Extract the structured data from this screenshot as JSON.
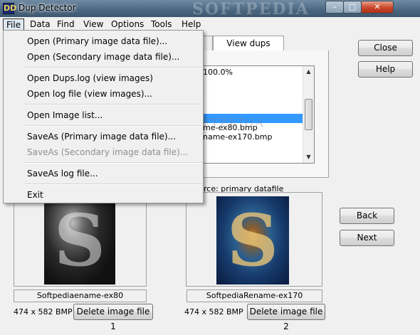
{
  "window": {
    "title": "Dup Detector",
    "watermark": "SOFTPEDIA",
    "app_icon": "DD",
    "minimize_glyph": "–",
    "maximize_glyph": "□",
    "close_glyph": "✕"
  },
  "menubar": {
    "items": [
      "File",
      "Data",
      "Find",
      "View",
      "Options",
      "Tools",
      "Help"
    ],
    "active": "File"
  },
  "file_menu": {
    "groups": [
      [
        {
          "label": "Open (Primary image data file)...",
          "enabled": true
        },
        {
          "label": "Open (Secondary image data file)...",
          "enabled": true
        }
      ],
      [
        {
          "label": "Open Dups.log (view images)",
          "enabled": true
        },
        {
          "label": "Open log file (view images)...",
          "enabled": true
        }
      ],
      [
        {
          "label": "Open Image list...",
          "enabled": true
        }
      ],
      [
        {
          "label": "SaveAs (Primary image data file)...",
          "enabled": true
        },
        {
          "label": "SaveAs (Secondary image data file)...",
          "enabled": false
        }
      ],
      [
        {
          "label": "SaveAs log file...",
          "enabled": true
        }
      ],
      [
        {
          "label": "Exit",
          "enabled": true
        }
      ]
    ]
  },
  "tabs": {
    "active_tab": "View dups"
  },
  "dups_list": {
    "rows": [
      "100.0%",
      "",
      "",
      "",
      "me-ex80.bmp",
      "name-ex170.bmp"
    ],
    "selected_index": 3
  },
  "buttons": {
    "close": "Close",
    "help": "Help",
    "back": "Back",
    "next": "Next"
  },
  "source_label": "rce: primary datafile",
  "center_watermark": "SOFTPEDIA",
  "images": {
    "left": {
      "name": "Softpediaename-ex80",
      "info": "474 x 582 BMP",
      "delete_label": "Delete image file 1"
    },
    "right": {
      "name": "SoftpediaRename-ex170",
      "info": "474 x 582 BMP",
      "delete_label": "Delete image file 2"
    }
  },
  "scrollbar": {
    "up_glyph": "▲",
    "down_glyph": "▼"
  },
  "image_glyph": "S",
  "colors": {
    "selection": "#3399ff",
    "title_gradient_top": "#6f8aa3",
    "close_button": "#c8472a"
  }
}
